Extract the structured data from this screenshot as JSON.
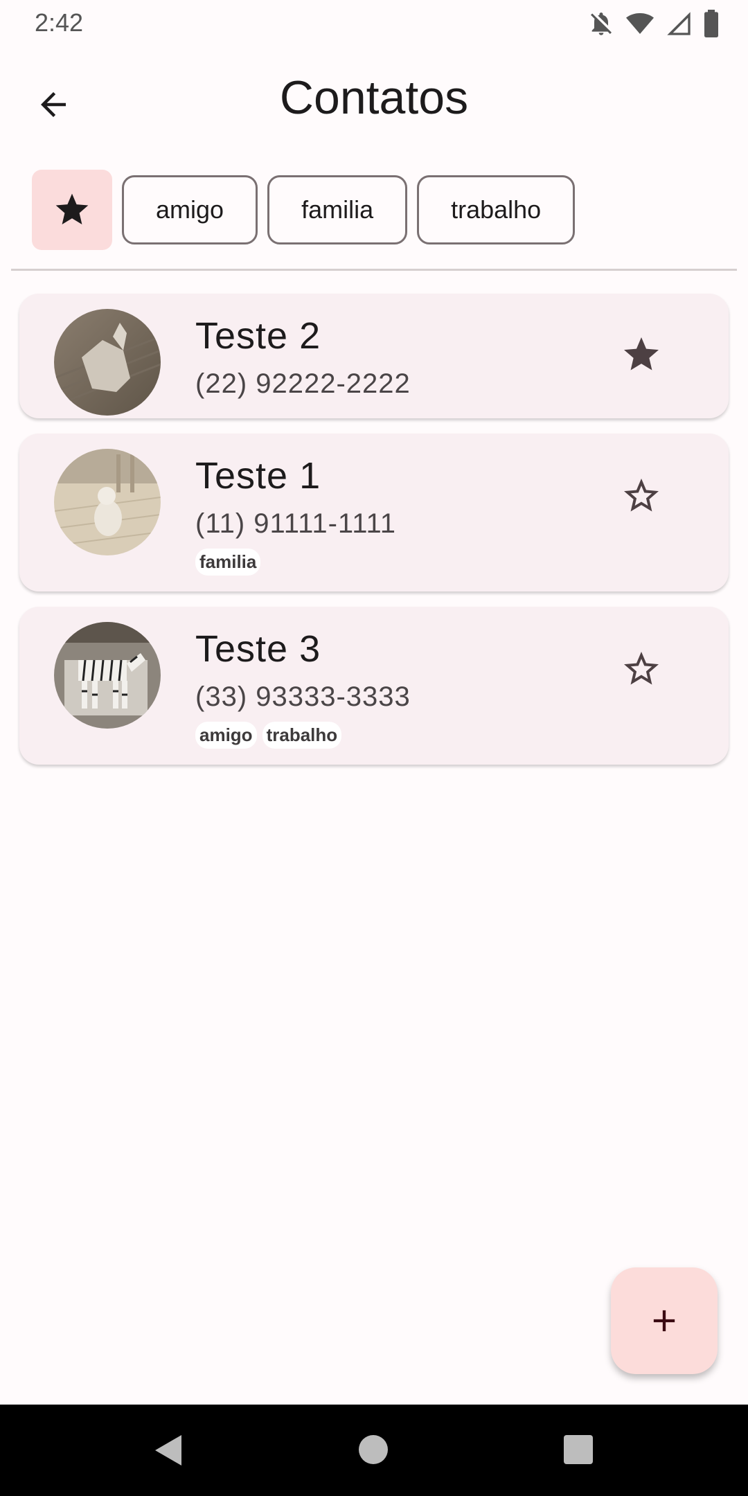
{
  "status_bar": {
    "time": "2:42",
    "icons": [
      "notifications-off-icon",
      "wifi-icon",
      "signal-icon",
      "battery-icon"
    ]
  },
  "app_bar": {
    "title": "Contatos",
    "back_icon": "arrow-back-icon"
  },
  "filters": {
    "favorite_icon": "star-filled-icon",
    "chips": [
      {
        "label": "amigo"
      },
      {
        "label": "familia"
      },
      {
        "label": "trabalho"
      }
    ]
  },
  "contacts": [
    {
      "name": "Teste 2",
      "phone": "(22) 92222-2222",
      "favorite": true,
      "tags": [],
      "avatar": "cat-paper-sculpture"
    },
    {
      "name": "Teste 1",
      "phone": "(11) 91111-1111",
      "favorite": false,
      "tags": [
        "familia"
      ],
      "avatar": "cat-figurine-room"
    },
    {
      "name": "Teste 3",
      "phone": "(33) 93333-3333",
      "favorite": false,
      "tags": [
        "amigo",
        "trabalho"
      ],
      "avatar": "zebra-figurine"
    }
  ],
  "fab": {
    "icon": "add-icon"
  },
  "nav_bar": {
    "icons": [
      "nav-back-icon",
      "nav-home-icon",
      "nav-recents-icon"
    ]
  },
  "colors": {
    "background": "#fffbfc",
    "card": "#f9eff2",
    "fab": "#fcdcda",
    "favorite_chip": "#fbdcdc",
    "star": "#4d4043"
  }
}
